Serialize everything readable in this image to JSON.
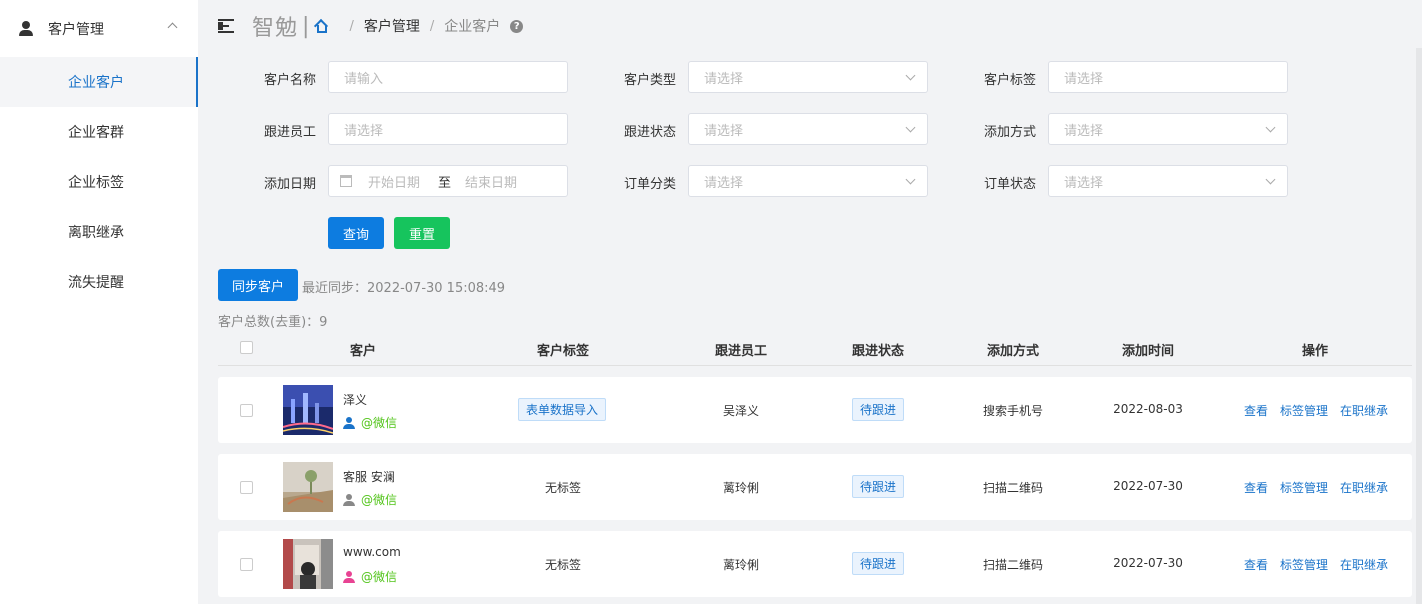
{
  "sidebar": {
    "title": "客户管理",
    "items": [
      {
        "label": "企业客户"
      },
      {
        "label": "企业客群"
      },
      {
        "label": "企业标签"
      },
      {
        "label": "离职继承"
      },
      {
        "label": "流失提醒"
      }
    ]
  },
  "header": {
    "brand": "智勉",
    "separator": "|",
    "breadcrumb": [
      "客户管理",
      "企业客户"
    ],
    "bc_sep": "/",
    "help": "?"
  },
  "filters": {
    "name_label": "客户名称",
    "name_placeholder": "请输入",
    "type_label": "客户类型",
    "type_placeholder": "请选择",
    "tag_label": "客户标签",
    "tag_placeholder": "请选择",
    "staff_label": "跟进员工",
    "staff_placeholder": "请选择",
    "status_label": "跟进状态",
    "status_placeholder": "请选择",
    "method_label": "添加方式",
    "method_placeholder": "请选择",
    "date_label": "添加日期",
    "date_start": "开始日期",
    "date_sep": "至",
    "date_end": "结束日期",
    "order_cat_label": "订单分类",
    "order_cat_placeholder": "请选择",
    "order_status_label": "订单状态",
    "order_status_placeholder": "请选择"
  },
  "actions": {
    "query": "查询",
    "reset": "重置",
    "sync": "同步客户",
    "last_sync": "最近同步：2022-07-30 15:08:49",
    "total": "客户总数(去重)：9"
  },
  "table": {
    "headers": [
      "客户",
      "客户标签",
      "跟进员工",
      "跟进状态",
      "添加方式",
      "添加时间",
      "操作"
    ],
    "rows": [
      {
        "name": "泽义",
        "source": "@微信",
        "tag": "表单数据导入",
        "staff": "吴泽义",
        "status": "待跟进",
        "method": "搜索手机号",
        "date": "2022-08-03",
        "icon_color": "#1a73c9"
      },
      {
        "name": "客服 安澜",
        "source": "@微信",
        "tag": "无标签",
        "staff": "蓠玲俐",
        "status": "待跟进",
        "method": "扫描二维码",
        "date": "2022-07-30",
        "icon_color": "#888888"
      },
      {
        "name": "www.com",
        "source": "@微信",
        "tag": "无标签",
        "staff": "蓠玲俐",
        "status": "待跟进",
        "method": "扫描二维码",
        "date": "2022-07-30",
        "icon_color": "#e84393"
      }
    ],
    "ops": [
      "查看",
      "标签管理",
      "在职继承"
    ]
  }
}
